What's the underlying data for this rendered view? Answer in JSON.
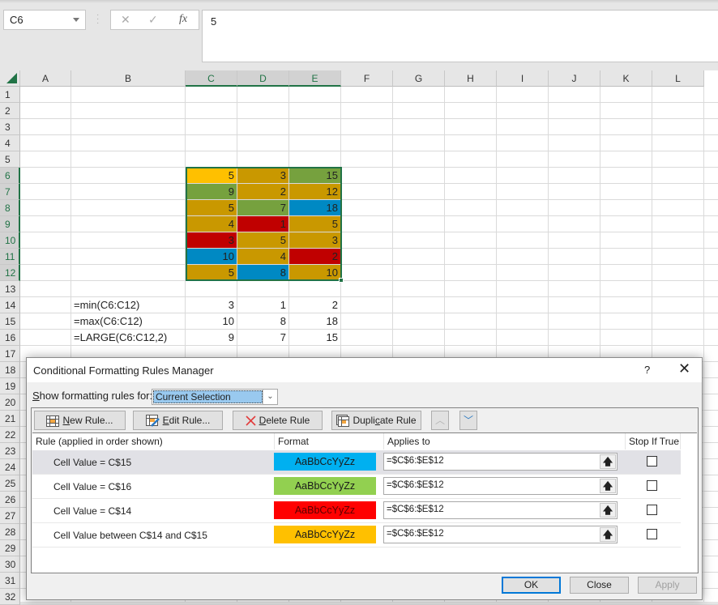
{
  "formula_bar": {
    "name_box": "C6",
    "cancel_glyph": "✕",
    "enter_glyph": "✓",
    "fx_glyph": "fx",
    "formula": "5"
  },
  "columns": [
    "A",
    "B",
    "C",
    "D",
    "E",
    "F",
    "G",
    "H",
    "I",
    "J",
    "K",
    "L"
  ],
  "rows": [
    "1",
    "2",
    "3",
    "4",
    "5",
    "6",
    "7",
    "8",
    "9",
    "10",
    "11",
    "12",
    "13",
    "14",
    "15",
    "16",
    "17",
    "18",
    "19",
    "20",
    "21",
    "22",
    "23",
    "24",
    "25",
    "26",
    "27",
    "28",
    "29",
    "30",
    "31",
    "32"
  ],
  "grid": {
    "data": [
      {
        "row": 6,
        "C": {
          "v": "5",
          "fill": "#FFC000"
        },
        "D": {
          "v": "3",
          "fill": "#C99800"
        },
        "E": {
          "v": "15",
          "fill": "#76A13E"
        }
      },
      {
        "row": 7,
        "C": {
          "v": "9",
          "fill": "#76A13E"
        },
        "D": {
          "v": "2",
          "fill": "#C99800"
        },
        "E": {
          "v": "12",
          "fill": "#C99800"
        }
      },
      {
        "row": 8,
        "C": {
          "v": "5",
          "fill": "#C99800"
        },
        "D": {
          "v": "7",
          "fill": "#76A13E"
        },
        "E": {
          "v": "18",
          "fill": "#0089C3"
        }
      },
      {
        "row": 9,
        "C": {
          "v": "4",
          "fill": "#C99800"
        },
        "D": {
          "v": "1",
          "fill": "#C00000"
        },
        "E": {
          "v": "5",
          "fill": "#C99800"
        }
      },
      {
        "row": 10,
        "C": {
          "v": "3",
          "fill": "#C00000"
        },
        "D": {
          "v": "5",
          "fill": "#C99800"
        },
        "E": {
          "v": "3",
          "fill": "#C99800"
        }
      },
      {
        "row": 11,
        "C": {
          "v": "10",
          "fill": "#0089C3"
        },
        "D": {
          "v": "4",
          "fill": "#C99800"
        },
        "E": {
          "v": "2",
          "fill": "#C00000"
        }
      },
      {
        "row": 12,
        "C": {
          "v": "5",
          "fill": "#C99800"
        },
        "D": {
          "v": "8",
          "fill": "#0089C3"
        },
        "E": {
          "v": "10",
          "fill": "#C99800"
        }
      }
    ],
    "summary": [
      {
        "row": 14,
        "B": "=min(C6:C12)",
        "C": "3",
        "D": "1",
        "E": "2"
      },
      {
        "row": 15,
        "B": "=max(C6:C12)",
        "C": "10",
        "D": "8",
        "E": "18"
      },
      {
        "row": 16,
        "B": "=LARGE(C6:C12,2)",
        "C": "9",
        "D": "7",
        "E": "15"
      }
    ]
  },
  "dialog": {
    "title": "Conditional Formatting Rules Manager",
    "help": "?",
    "close_glyph": "✕",
    "show_label_u": "S",
    "show_label_rest": "how formatting rules for:",
    "scope_value": "Current Selection",
    "toolbar": {
      "new_rule_u": "N",
      "new_rule_rest": "ew Rule...",
      "edit_rule_u": "E",
      "edit_rule_rest": "dit Rule...",
      "delete_rule_u": "D",
      "delete_rule_rest": "elete Rule",
      "duplicate_pre": "Dupli",
      "duplicate_u": "c",
      "duplicate_rest": "ate Rule",
      "move_up_glyph": "︿",
      "move_down_glyph": "﹀"
    },
    "columns": {
      "rule": "Rule (applied in order shown)",
      "format": "Format",
      "applies_to": "Applies to",
      "stop_if_true": "Stop If True"
    },
    "rules": [
      {
        "rule": "Cell Value = C$15",
        "preview": "AaBbCcYyZz",
        "fill": "#00B0F0",
        "text_color": "#1a1a1a",
        "applies_to": "=$C$6:$E$12",
        "stop_if_true": false,
        "selected": true
      },
      {
        "rule": "Cell Value = C$16",
        "preview": "AaBbCcYyZz",
        "fill": "#92D050",
        "text_color": "#1a1a1a",
        "applies_to": "=$C$6:$E$12",
        "stop_if_true": false,
        "selected": false
      },
      {
        "rule": "Cell Value = C$14",
        "preview": "AaBbCcYyZz",
        "fill": "#FF0000",
        "text_color": "#5a0000",
        "applies_to": "=$C$6:$E$12",
        "stop_if_true": false,
        "selected": false
      },
      {
        "rule": "Cell Value between C$14 and C$15",
        "preview": "AaBbCcYyZz",
        "fill": "#FFC000",
        "text_color": "#1a1a1a",
        "applies_to": "=$C$6:$E$12",
        "stop_if_true": false,
        "selected": false
      }
    ],
    "ok": "OK",
    "close": "Close",
    "apply": "Apply"
  }
}
